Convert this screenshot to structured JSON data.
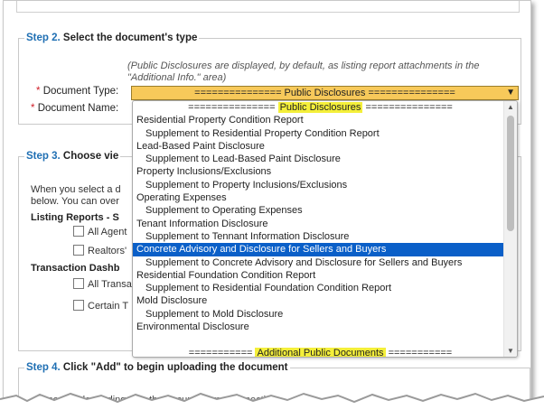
{
  "step2": {
    "number": "Step 2.",
    "title": "Select the document's type",
    "note": "(Public Disclosures are displayed, by default, as listing report attachments in the \"Additional Info.\" area)",
    "doc_type_label": "Document Type:",
    "doc_name_label": "Document Name:",
    "required_mark": "*",
    "selected_value": "=============== Public Disclosures ==============="
  },
  "step3": {
    "number": "Step 3.",
    "title": "Choose vie",
    "intro_line1": "When you select a d",
    "intro_line2": "below. You can over",
    "listing_reports_label": "Listing Reports - S",
    "all_agents": "All Agent",
    "realtors": "Realtors'",
    "transaction_label": "Transaction Dashb",
    "all_trans": "All Transa",
    "certain": "Certain T"
  },
  "step4": {
    "number": "Step 4.",
    "title": "Click \"Add\" to begin uploading the document",
    "fragment": "times va    depending    size   the document  mo      connectio"
  },
  "dropdown": {
    "options": [
      {
        "text": "=============== ",
        "hl": "Public Disclosures",
        "tail": " ===============",
        "type": "group"
      },
      {
        "text": "Residential Property Condition Report",
        "type": "item"
      },
      {
        "text": "Supplement to Residential Property Condition Report",
        "type": "sub"
      },
      {
        "text": "Lead-Based Paint Disclosure",
        "type": "item"
      },
      {
        "text": "Supplement to Lead-Based Paint Disclosure",
        "type": "sub"
      },
      {
        "text": "Property Inclusions/Exclusions",
        "type": "item"
      },
      {
        "text": "Supplement to Property Inclusions/Exclusions",
        "type": "sub"
      },
      {
        "text": "Operating Expenses",
        "type": "item"
      },
      {
        "text": "Supplement to Operating Expenses",
        "type": "sub"
      },
      {
        "text": "Tenant Information Disclosure",
        "type": "item"
      },
      {
        "text": "Supplement to Tennant Information Disclosure",
        "type": "sub"
      },
      {
        "text": "Concrete Advisory and Disclosure for Sellers and Buyers",
        "type": "selected"
      },
      {
        "text": "Supplement to Concrete Advisory and Disclosure for Sellers and Buyers",
        "type": "sub"
      },
      {
        "text": "Residential Foundation Condition Report",
        "type": "item"
      },
      {
        "text": "Supplement to Residential Foundation Condition Report",
        "type": "sub"
      },
      {
        "text": "Mold Disclosure",
        "type": "item"
      },
      {
        "text": "Supplement to Mold Disclosure",
        "type": "sub"
      },
      {
        "text": "Environmental Disclosure",
        "type": "item"
      },
      {
        "text": "",
        "type": "blank"
      },
      {
        "text": "=========== ",
        "hl": "Additional Public Documents",
        "tail": " ===========",
        "type": "group"
      }
    ]
  },
  "colors": {
    "select_bg": "#f7c95a",
    "selected_option": "#0a5fc8",
    "highlight": "#f4ef3a",
    "step_number": "#1f6fb3",
    "required": "#d0202a"
  }
}
